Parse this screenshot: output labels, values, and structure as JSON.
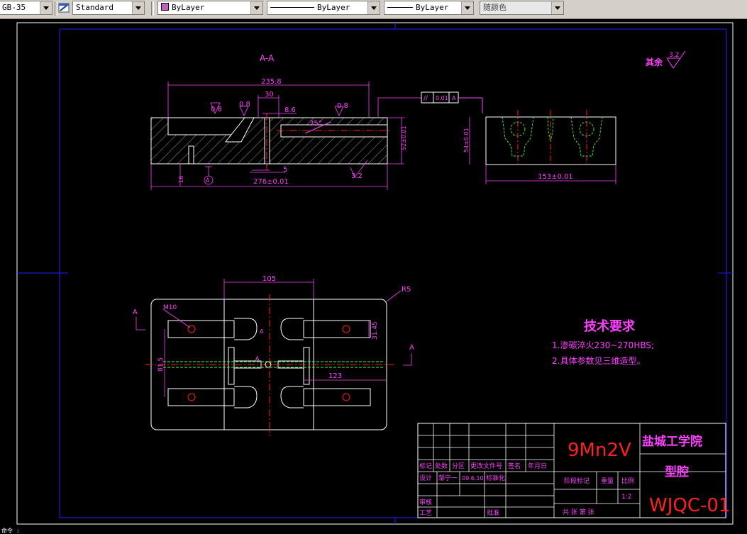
{
  "toolbar": {
    "textstyle": "GB-35",
    "dimstyle": "Standard",
    "layer": "ByLayer",
    "linetype": "ByLayer",
    "lineweight": "ByLayer",
    "plotstyle": "随颜色"
  },
  "drawing": {
    "section_label": "A-A",
    "roughness_note": "其余",
    "roughness_value": "3.2",
    "dims_top": {
      "d_235_8": "235.8",
      "d_30": "30",
      "d_8_6": "8.6",
      "d_0_8a": "0.8",
      "d_0_8b": "0.8",
      "d_0_8c": "0.8",
      "d_35": "35°",
      "d_52": "52±0.01",
      "d_16": "16",
      "d_5": "5",
      "d_276": "276±0.01",
      "d_3_2": "3.2",
      "datum": "A",
      "tol_sym": "//",
      "tol_val": "0.01",
      "tol_ref": "A",
      "d_54": "54±0.01",
      "d_153": "153±0.01"
    },
    "dims_plan": {
      "d_105": "105",
      "r5": "R5",
      "m10": "M10",
      "d_31_45": "31.45",
      "d_81_5": "81.5",
      "d_123": "123",
      "sec_a_left": "A",
      "sec_a_right": "A",
      "a_small1": "A",
      "a_small2": "A"
    },
    "tech": {
      "title": "技术要求",
      "line1": "1.渗碳淬火230~270HBS;",
      "line2": "2.具体参数见三维造型。"
    },
    "titleblock": {
      "material": "9Mn2V",
      "school": "盐城工学院",
      "part": "型腔",
      "code": "WJQC-01",
      "h_mark": "标记",
      "h_count": "处数",
      "h_zone": "分区",
      "h_docno": "更改文件号",
      "h_sign": "签名",
      "h_date": "年月日",
      "r_design": "设计",
      "r_designer": "邹宁一",
      "r_date": "09.6.10",
      "r_std": "标准化",
      "r_review": "审核",
      "r_process": "工艺",
      "r_approve": "批准",
      "c_stage": "阶段标记",
      "c_weight": "重量",
      "c_scale": "比例",
      "scale_val": "1:2",
      "sheets": "共  张 第  张"
    }
  },
  "status_text": "命令 :"
}
